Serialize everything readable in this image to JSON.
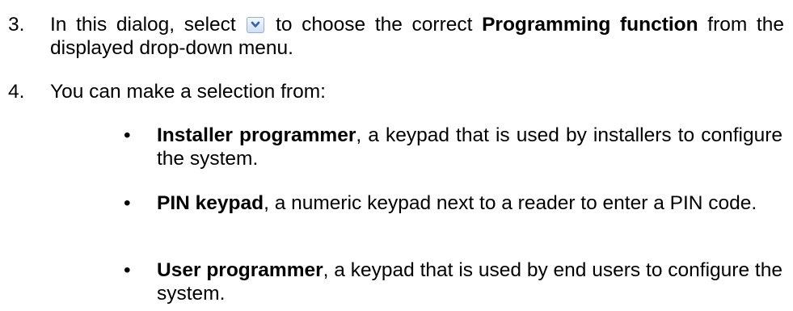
{
  "steps": [
    {
      "number": "3.",
      "before_icon": "In this dialog, select",
      "icon": "chevron-down-icon",
      "after_icon": " to choose the correct ",
      "bold": "Programming function",
      "after_bold": " from the displayed drop-down menu."
    },
    {
      "number": "4.",
      "text": "You can make a selection from:"
    }
  ],
  "bullets": [
    {
      "symbol": "•",
      "term": "Installer programmer",
      "description": ", a keypad that is used by installers to configure the system."
    },
    {
      "symbol": "•",
      "term": "PIN keypad",
      "description": ", a numeric keypad next to a reader to enter a PIN code."
    },
    {
      "symbol": "•",
      "term": "User programmer",
      "description": ", a keypad that is used by end users to configure the system."
    }
  ],
  "colors": {
    "icon_border": "#8fb0d8",
    "icon_chevron": "#2d63b4"
  }
}
